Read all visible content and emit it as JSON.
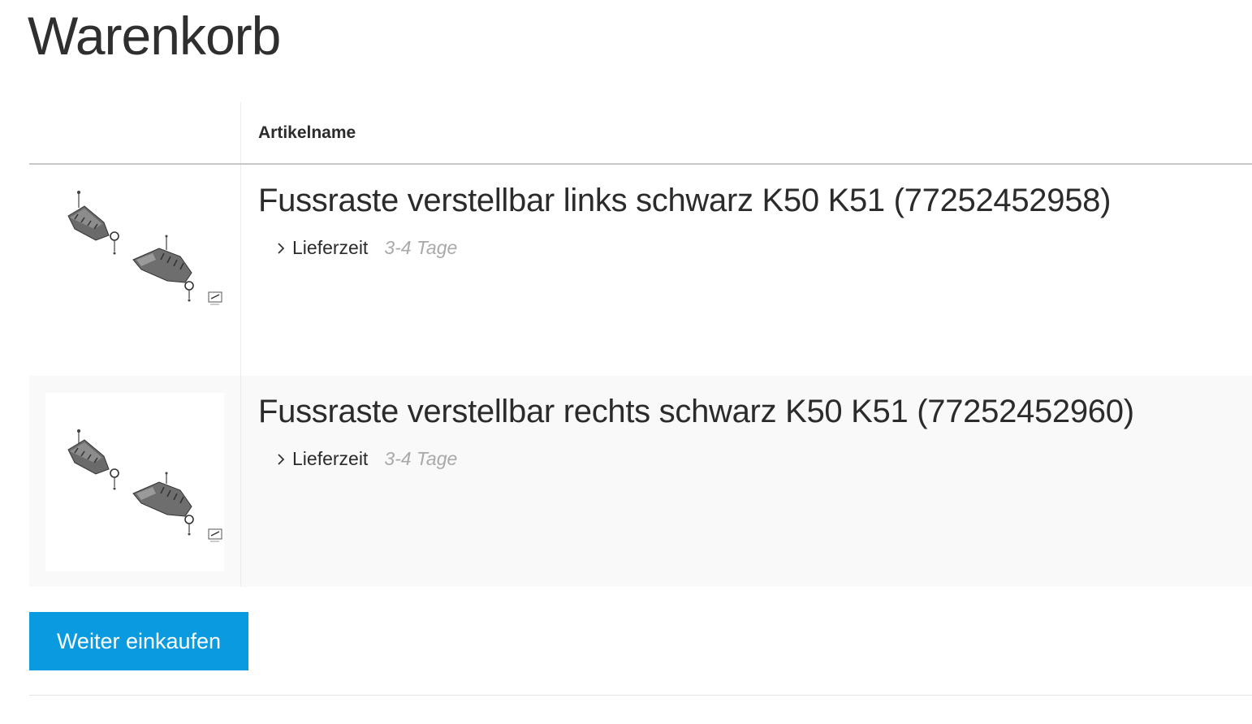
{
  "page": {
    "title": "Warenkorb"
  },
  "table": {
    "header_name": "Artikelname"
  },
  "items": [
    {
      "name": "Fussraste verstellbar links schwarz K50 K51 (77252452958)",
      "delivery_label": "Lieferzeit",
      "delivery_value": "3-4 Tage",
      "image_icon": "footpeg-parts-diagram"
    },
    {
      "name": "Fussraste verstellbar rechts schwarz K50 K51 (77252452960)",
      "delivery_label": "Lieferzeit",
      "delivery_value": "3-4 Tage",
      "image_icon": "footpeg-parts-diagram"
    }
  ],
  "actions": {
    "continue_shopping": "Weiter einkaufen"
  },
  "colors": {
    "accent": "#0a9ae0",
    "muted_text": "#a9a9a9",
    "alt_row": "#f9f9f9"
  }
}
